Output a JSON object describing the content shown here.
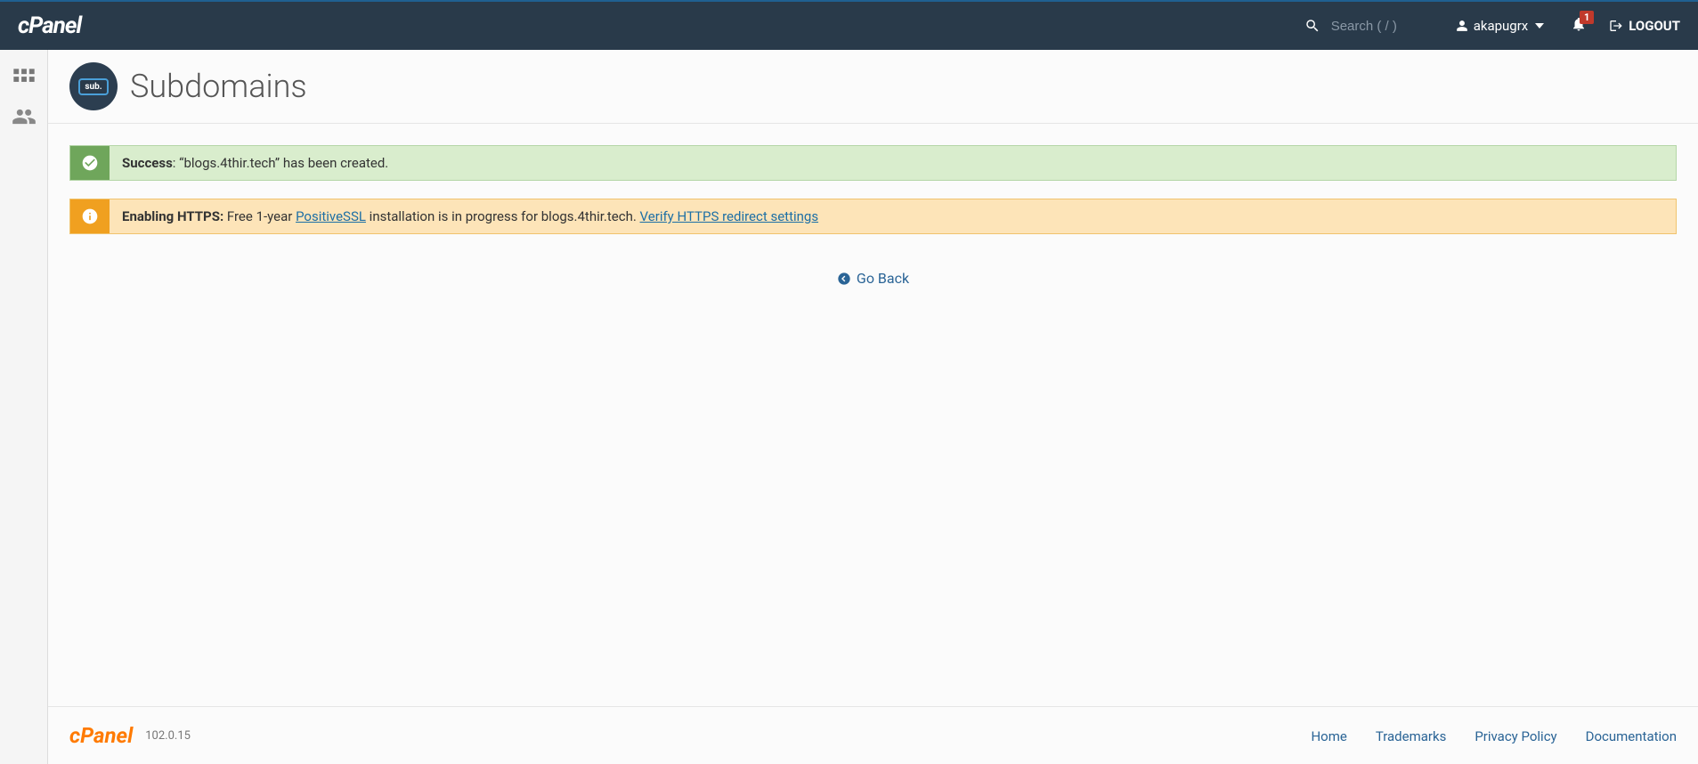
{
  "header": {
    "logo": "cPanel",
    "search_placeholder": "Search ( / )",
    "user_name": "akapugrx",
    "notification_count": "1",
    "logout_label": "LOGOUT"
  },
  "page": {
    "title": "Subdomains",
    "icon_sub_label": "sub."
  },
  "alerts": {
    "success": {
      "label": "Success",
      "message": ": “blogs.4thir.tech” has been created."
    },
    "info": {
      "label": "Enabling HTTPS:",
      "msg_before_link1": " Free 1-year ",
      "link1_text": "PositiveSSL",
      "msg_after_link1": " installation is in progress for blogs.4thir.tech. ",
      "link2_text": "Verify HTTPS redirect settings"
    }
  },
  "nav": {
    "go_back": "Go Back"
  },
  "footer": {
    "logo": "cPanel",
    "version": "102.0.15",
    "links": {
      "home": "Home",
      "trademarks": "Trademarks",
      "privacy": "Privacy Policy",
      "documentation": "Documentation"
    }
  }
}
